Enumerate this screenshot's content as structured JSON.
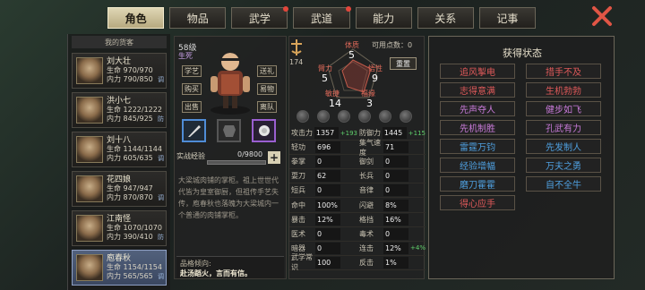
{
  "tabs": [
    {
      "label": "角色",
      "active": true,
      "dot": false
    },
    {
      "label": "物品",
      "active": false,
      "dot": false
    },
    {
      "label": "武学",
      "active": false,
      "dot": true
    },
    {
      "label": "武道",
      "active": false,
      "dot": true
    },
    {
      "label": "能力",
      "active": false,
      "dot": false
    },
    {
      "label": "关系",
      "active": false,
      "dot": false
    },
    {
      "label": "记事",
      "active": false,
      "dot": false
    }
  ],
  "party": {
    "title": "我的货客",
    "members": [
      {
        "name": "刘大壮",
        "hp": "生命 970/970",
        "mp": "内力 790/850",
        "flag": "调"
      },
      {
        "name": "洪小七",
        "hp": "生命 1222/1222",
        "mp": "内力 845/925",
        "flag": "防"
      },
      {
        "name": "刘十八",
        "hp": "生命 1144/1144",
        "mp": "内力 605/635",
        "flag": "调"
      },
      {
        "name": "花四娘",
        "hp": "生命 947/947",
        "mp": "内力 870/870",
        "flag": "调"
      },
      {
        "name": "江南怪",
        "hp": "生命 1070/1070",
        "mp": "内力 390/410",
        "flag": "防"
      },
      {
        "name": "庖春秋",
        "hp": "生命 1154/1154",
        "mp": "内力 565/565",
        "flag": "调"
      }
    ]
  },
  "character": {
    "level": "58级",
    "life": "生死",
    "buttons": {
      "skill": "学艺",
      "gift": "送礼",
      "buy": "购买",
      "trade": "易物",
      "travel": "出售",
      "leave": "离队"
    },
    "xp_label": "实战经验",
    "xp_value": "0/9800",
    "xp_fraction": 0,
    "desc": "大梁城肉铺的掌柜。祖上世世代代皆为皇室御厨，但祖传手艺失传，庖春秋也落魄为大梁城内一个普通的肉铺掌柜。",
    "trait_label": "品格倾向:",
    "trait_value": "赴汤蹈火，言而有信。"
  },
  "attrs": {
    "points_icon_value": "174",
    "free_points": "可用点数：0",
    "reset": "重置",
    "physique_label": "体质",
    "physique": "5",
    "str_label": "臂力",
    "str": "5",
    "wit_label": "悟性",
    "wit": "9",
    "agi_label": "敏捷",
    "agi": "14",
    "fu_label": "福缘",
    "fu": "3"
  },
  "stats": [
    [
      {
        "k": "攻击力",
        "v": "1357",
        "d": "+193"
      },
      {
        "k": "防御力",
        "v": "1445",
        "d": "+115"
      }
    ],
    [
      {
        "k": "轻功",
        "v": "696",
        "d": ""
      },
      {
        "k": "集气速度",
        "v": "71",
        "d": ""
      }
    ],
    [
      {
        "k": "拳掌",
        "v": "0",
        "d": ""
      },
      {
        "k": "御剑",
        "v": "0",
        "d": ""
      }
    ],
    [
      {
        "k": "耍刀",
        "v": "62",
        "d": ""
      },
      {
        "k": "长兵",
        "v": "0",
        "d": ""
      }
    ],
    [
      {
        "k": "短兵",
        "v": "0",
        "d": ""
      },
      {
        "k": "音律",
        "v": "0",
        "d": ""
      }
    ],
    [
      {
        "k": "命中",
        "v": "100%",
        "d": ""
      },
      {
        "k": "闪避",
        "v": "8%",
        "d": ""
      }
    ],
    [
      {
        "k": "暴击",
        "v": "12%",
        "d": ""
      },
      {
        "k": "格挡",
        "v": "16%",
        "d": ""
      }
    ],
    [
      {
        "k": "医术",
        "v": "0",
        "d": ""
      },
      {
        "k": "毒术",
        "v": "0",
        "d": ""
      }
    ],
    [
      {
        "k": "暗器",
        "v": "0",
        "d": ""
      },
      {
        "k": "连击",
        "v": "12%",
        "d": "+4%"
      }
    ],
    [
      {
        "k": "武学常识",
        "v": "100",
        "d": ""
      },
      {
        "k": "反击",
        "v": "1%",
        "d": ""
      }
    ]
  ],
  "status": {
    "title": "获得状态",
    "items": [
      {
        "label": "追风掣电",
        "color": "red"
      },
      {
        "label": "措手不及",
        "color": "red"
      },
      {
        "label": "志得意满",
        "color": "red"
      },
      {
        "label": "生机勃勃",
        "color": "red"
      },
      {
        "label": "先声夺人",
        "color": "purple"
      },
      {
        "label": "健步如飞",
        "color": "purple"
      },
      {
        "label": "先机制胜",
        "color": "purple"
      },
      {
        "label": "孔武有力",
        "color": "purple"
      },
      {
        "label": "雷霆万钧",
        "color": "blue"
      },
      {
        "label": "先发制人",
        "color": "blue"
      },
      {
        "label": "经验增幅",
        "color": "blue"
      },
      {
        "label": "万夫之勇",
        "color": "blue"
      },
      {
        "label": "磨刀霍霍",
        "color": "blue"
      },
      {
        "label": "自不全牛",
        "color": "blue"
      },
      {
        "label": "得心应手",
        "color": "red"
      }
    ]
  }
}
